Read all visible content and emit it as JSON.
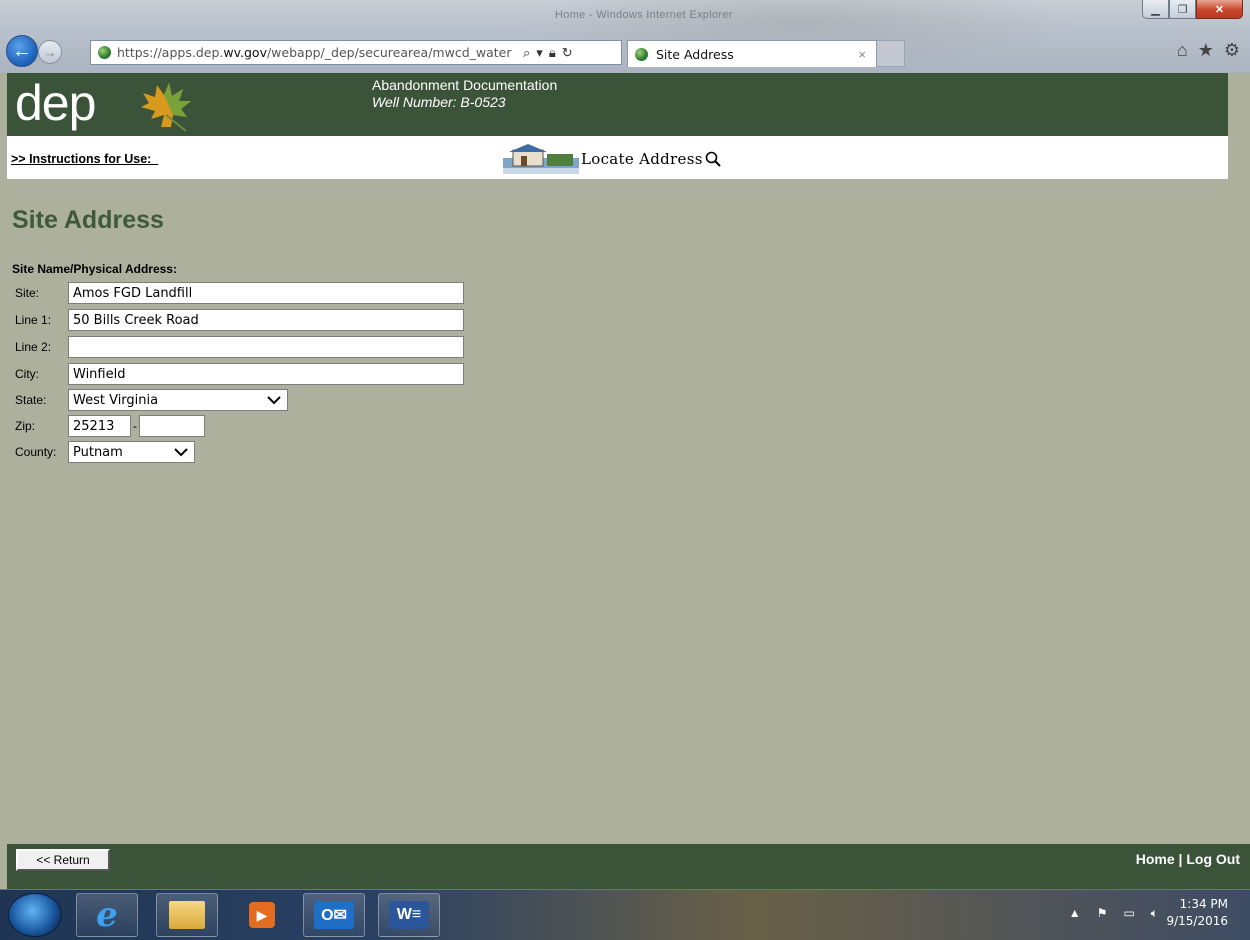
{
  "browser": {
    "window_title": "Home - Windows Internet Explorer",
    "url_prefix": "https://apps.dep.",
    "url_domain": "wv.gov",
    "url_rest": "/webapp/_dep/securearea/mwcd_water",
    "tab_title": "Site Address",
    "tab_close": "×"
  },
  "header": {
    "logo_text": "dep",
    "title": "Abandonment Documentation",
    "subtitle": "Well Number: B-0523"
  },
  "subbar": {
    "instructions_link": ">> Instructions for Use:  ",
    "locate_label": "Locate Address"
  },
  "main": {
    "page_title": "Site Address",
    "section_label": "Site Name/Physical Address:",
    "fields": {
      "site": {
        "label": "Site:",
        "value": "Amos FGD Landfill"
      },
      "line1": {
        "label": "Line 1:",
        "value": "50 Bills Creek Road"
      },
      "line2": {
        "label": "Line 2:",
        "value": ""
      },
      "city": {
        "label": "City:",
        "value": "Winfield"
      },
      "state": {
        "label": "State:",
        "value": "West Virginia"
      },
      "zip": {
        "label": "Zip:",
        "value": "25213",
        "ext": "",
        "separator": "-"
      },
      "county": {
        "label": "County:",
        "value": "Putnam"
      }
    }
  },
  "footer": {
    "return_label": "<< Return",
    "home_link": "Home",
    "separator": " | ",
    "logout_link": "Log Out"
  },
  "taskbar": {
    "time": "1:34 PM",
    "date": "9/15/2016",
    "apps": [
      "start-orb-icon",
      "internet-explorer-icon",
      "file-explorer-icon",
      "media-player-icon",
      "outlook-icon",
      "word-icon"
    ]
  },
  "colors": {
    "header_green": "#3b5339",
    "page_bg": "#aeb09e",
    "title_green": "#3d5a3b"
  }
}
